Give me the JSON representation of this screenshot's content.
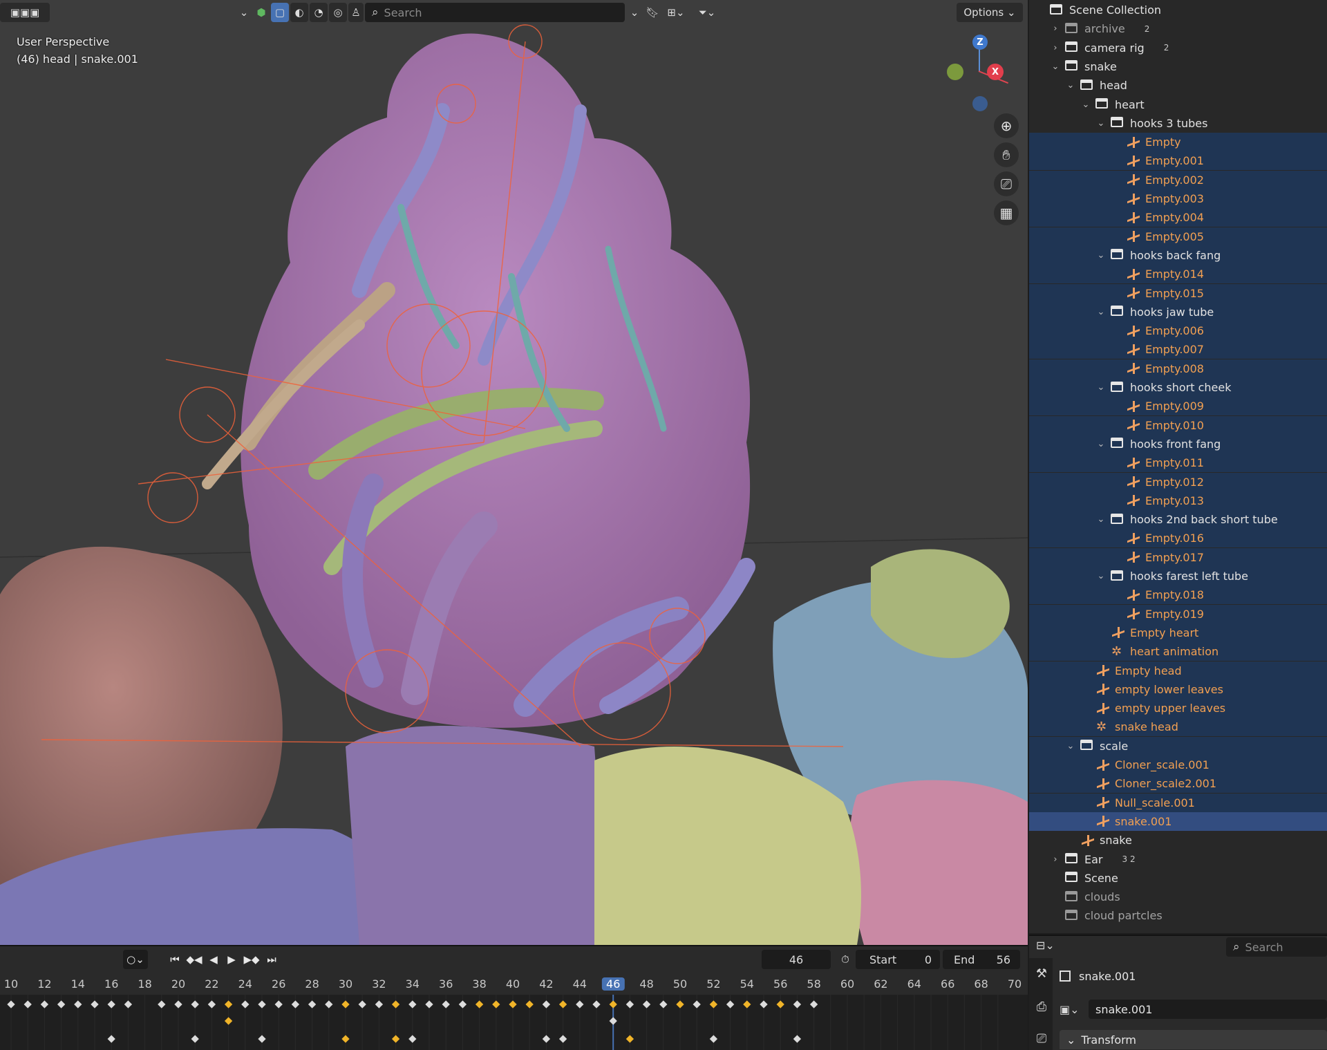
{
  "viewport": {
    "header": {
      "search_placeholder": "Search",
      "options_label": "Options",
      "dropdown_glyph": "⌄"
    },
    "info": {
      "perspective": "User Perspective",
      "context": "(46) head | snake.001"
    },
    "gizmo": {
      "z": "Z",
      "x": "X"
    }
  },
  "timeline": {
    "current_frame": "46",
    "start_label": "Start",
    "start_value": "0",
    "end_label": "End",
    "end_value": "56",
    "ruler": [
      "10",
      "12",
      "14",
      "16",
      "18",
      "20",
      "22",
      "24",
      "26",
      "28",
      "30",
      "32",
      "34",
      "36",
      "38",
      "40",
      "42",
      "44",
      "46",
      "48",
      "50",
      "52",
      "54",
      "56",
      "58",
      "60",
      "62",
      "64",
      "66",
      "68",
      "70"
    ]
  },
  "outliner": {
    "rows": [
      {
        "label": "Scene Collection",
        "icon": "collection-icon",
        "indent": 0,
        "arrow": "",
        "state": ""
      },
      {
        "label": "archive",
        "icon": "collection-icon",
        "indent": 1,
        "arrow": "›",
        "state": "dim",
        "badge": "2"
      },
      {
        "label": "camera rig",
        "icon": "collection-icon",
        "indent": 1,
        "arrow": "›",
        "state": "",
        "badge": "2"
      },
      {
        "label": "snake",
        "icon": "collection-icon",
        "indent": 1,
        "arrow": "⌄",
        "state": ""
      },
      {
        "label": "head",
        "icon": "collection-icon",
        "indent": 2,
        "arrow": "⌄",
        "state": ""
      },
      {
        "label": "heart",
        "icon": "collection-icon",
        "indent": 3,
        "arrow": "⌄",
        "state": ""
      },
      {
        "label": "hooks 3 tubes",
        "icon": "collection-icon",
        "indent": 4,
        "arrow": "⌄",
        "state": ""
      },
      {
        "label": "Empty",
        "icon": "empty-icon",
        "indent": 5,
        "arrow": "",
        "state": "sel"
      },
      {
        "label": "Empty.001",
        "icon": "empty-icon",
        "indent": 5,
        "arrow": "",
        "state": "sel"
      },
      {
        "label": "Empty.002",
        "icon": "empty-icon",
        "indent": 5,
        "arrow": "",
        "state": "sel"
      },
      {
        "label": "Empty.003",
        "icon": "empty-icon",
        "indent": 5,
        "arrow": "",
        "state": "sel"
      },
      {
        "label": "Empty.004",
        "icon": "empty-icon",
        "indent": 5,
        "arrow": "",
        "state": "sel"
      },
      {
        "label": "Empty.005",
        "icon": "empty-icon",
        "indent": 5,
        "arrow": "",
        "state": "sel"
      },
      {
        "label": "hooks back fang",
        "icon": "collection-icon",
        "indent": 4,
        "arrow": "⌄",
        "state": "sel"
      },
      {
        "label": "Empty.014",
        "icon": "empty-icon",
        "indent": 5,
        "arrow": "",
        "state": "sel"
      },
      {
        "label": "Empty.015",
        "icon": "empty-icon",
        "indent": 5,
        "arrow": "",
        "state": "sel"
      },
      {
        "label": "hooks jaw tube",
        "icon": "collection-icon",
        "indent": 4,
        "arrow": "⌄",
        "state": "sel"
      },
      {
        "label": "Empty.006",
        "icon": "empty-icon",
        "indent": 5,
        "arrow": "",
        "state": "sel"
      },
      {
        "label": "Empty.007",
        "icon": "empty-icon",
        "indent": 5,
        "arrow": "",
        "state": "sel"
      },
      {
        "label": "Empty.008",
        "icon": "empty-icon",
        "indent": 5,
        "arrow": "",
        "state": "sel"
      },
      {
        "label": "hooks short cheek",
        "icon": "collection-icon",
        "indent": 4,
        "arrow": "⌄",
        "state": "sel"
      },
      {
        "label": "Empty.009",
        "icon": "empty-icon",
        "indent": 5,
        "arrow": "",
        "state": "sel"
      },
      {
        "label": "Empty.010",
        "icon": "empty-icon",
        "indent": 5,
        "arrow": "",
        "state": "sel"
      },
      {
        "label": "hooks front fang",
        "icon": "collection-icon",
        "indent": 4,
        "arrow": "⌄",
        "state": "sel"
      },
      {
        "label": "Empty.011",
        "icon": "empty-icon",
        "indent": 5,
        "arrow": "",
        "state": "sel"
      },
      {
        "label": "Empty.012",
        "icon": "empty-icon",
        "indent": 5,
        "arrow": "",
        "state": "sel"
      },
      {
        "label": "Empty.013",
        "icon": "empty-icon",
        "indent": 5,
        "arrow": "",
        "state": "sel"
      },
      {
        "label": "hooks 2nd back short tube",
        "icon": "collection-icon",
        "indent": 4,
        "arrow": "⌄",
        "state": "sel"
      },
      {
        "label": "Empty.016",
        "icon": "empty-icon",
        "indent": 5,
        "arrow": "",
        "state": "sel"
      },
      {
        "label": "Empty.017",
        "icon": "empty-icon",
        "indent": 5,
        "arrow": "",
        "state": "sel"
      },
      {
        "label": "hooks farest left tube",
        "icon": "collection-icon",
        "indent": 4,
        "arrow": "⌄",
        "state": "sel"
      },
      {
        "label": "Empty.018",
        "icon": "empty-icon",
        "indent": 5,
        "arrow": "",
        "state": "sel"
      },
      {
        "label": "Empty.019",
        "icon": "empty-icon",
        "indent": 5,
        "arrow": "",
        "state": "sel"
      },
      {
        "label": "Empty heart",
        "icon": "empty-icon",
        "indent": 4,
        "arrow": "",
        "state": "sel"
      },
      {
        "label": "heart animation",
        "icon": "armature-icon",
        "indent": 4,
        "arrow": "",
        "state": "sel"
      },
      {
        "label": "Empty head",
        "icon": "empty-icon",
        "indent": 3,
        "arrow": "",
        "state": "sel"
      },
      {
        "label": "empty lower  leaves",
        "icon": "empty-icon",
        "indent": 3,
        "arrow": "",
        "state": "sel"
      },
      {
        "label": "empty upper leaves",
        "icon": "empty-icon",
        "indent": 3,
        "arrow": "",
        "state": "sel"
      },
      {
        "label": "snake head",
        "icon": "armature-icon",
        "indent": 3,
        "arrow": "",
        "state": "sel"
      },
      {
        "label": "scale",
        "icon": "collection-icon",
        "indent": 2,
        "arrow": "⌄",
        "state": "sel"
      },
      {
        "label": "Cloner_scale.001",
        "icon": "empty-icon",
        "indent": 3,
        "arrow": "",
        "state": "sel"
      },
      {
        "label": "Cloner_scale2.001",
        "icon": "empty-icon",
        "indent": 3,
        "arrow": "",
        "state": "sel"
      },
      {
        "label": "Null_scale.001",
        "icon": "empty-icon",
        "indent": 3,
        "arrow": "",
        "state": "sel"
      },
      {
        "label": "snake.001",
        "icon": "empty-icon",
        "indent": 3,
        "arrow": "",
        "state": "active"
      },
      {
        "label": "snake",
        "icon": "empty-icon",
        "indent": 2,
        "arrow": "",
        "state": "plain"
      },
      {
        "label": "Ear",
        "icon": "collection-icon",
        "indent": 1,
        "arrow": "›",
        "state": "",
        "badge": "3 2"
      },
      {
        "label": "Scene",
        "icon": "collection-icon",
        "indent": 1,
        "arrow": "",
        "state": ""
      },
      {
        "label": "clouds",
        "icon": "collection-icon",
        "indent": 1,
        "arrow": "",
        "state": "dim"
      },
      {
        "label": "cloud partcles",
        "icon": "collection-icon",
        "indent": 1,
        "arrow": "",
        "state": "dim"
      }
    ]
  },
  "properties": {
    "search_placeholder": "Search",
    "object_name": "snake.001",
    "data_name": "snake.001",
    "panel_transform": "Transform"
  },
  "colors": {
    "selection": "#1f3554",
    "active": "#334d80",
    "object_orange": "#f2a052",
    "accent_blue": "#4772b3"
  }
}
